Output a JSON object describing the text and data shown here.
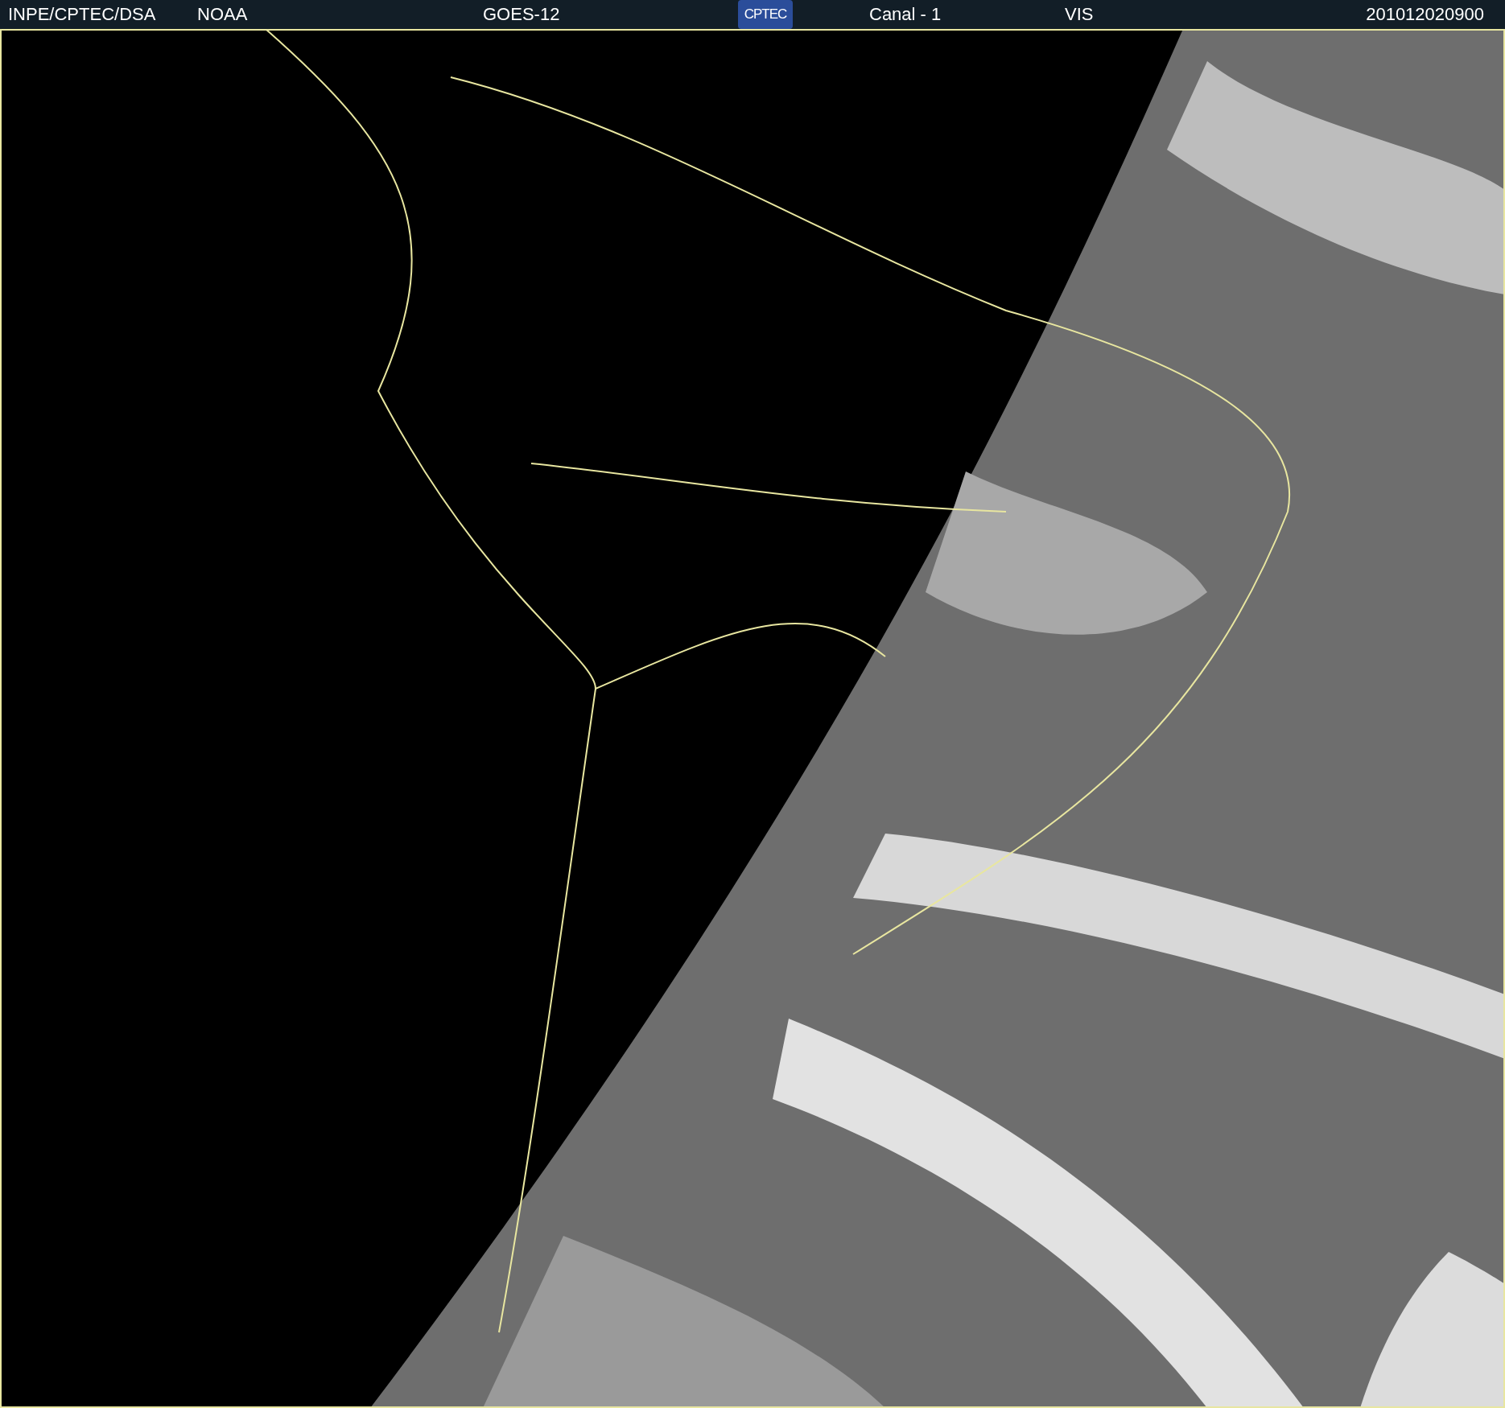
{
  "header": {
    "source": "INPE/CPTEC/DSA",
    "agency": "NOAA",
    "satellite": "GOES-12",
    "logo": "CPTEC",
    "channel": "Canal - 1",
    "band": "VIS",
    "timestamp": "201012020900"
  }
}
